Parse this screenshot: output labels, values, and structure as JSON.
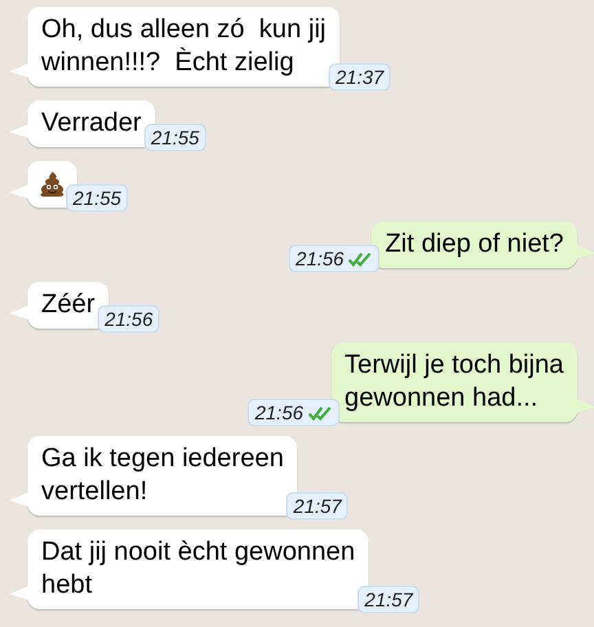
{
  "messages": [
    {
      "outgoing": false,
      "kind": "text",
      "text": "Oh, dus alleen zó  kun jij\nwinnen!!!?  Ècht zielig",
      "time": "21:37"
    },
    {
      "outgoing": false,
      "kind": "text",
      "text": "Verrader",
      "time": "21:55"
    },
    {
      "outgoing": false,
      "kind": "emoji",
      "time": "21:55"
    },
    {
      "outgoing": true,
      "kind": "text",
      "text": "Zit diep of niet?",
      "time": "21:56",
      "read": true
    },
    {
      "outgoing": false,
      "kind": "text",
      "text": "Zéér",
      "time": "21:56"
    },
    {
      "outgoing": true,
      "kind": "text",
      "text": "Terwijl je toch bijna\ngewonnen had...",
      "time": "21:56",
      "read": true
    },
    {
      "outgoing": false,
      "kind": "text",
      "text": "Ga ik tegen iedereen\nvertellen!",
      "time": "21:57"
    },
    {
      "outgoing": false,
      "kind": "text",
      "text": "Dat jij nooit ècht gewonnen\nhebt",
      "time": "21:57"
    }
  ]
}
